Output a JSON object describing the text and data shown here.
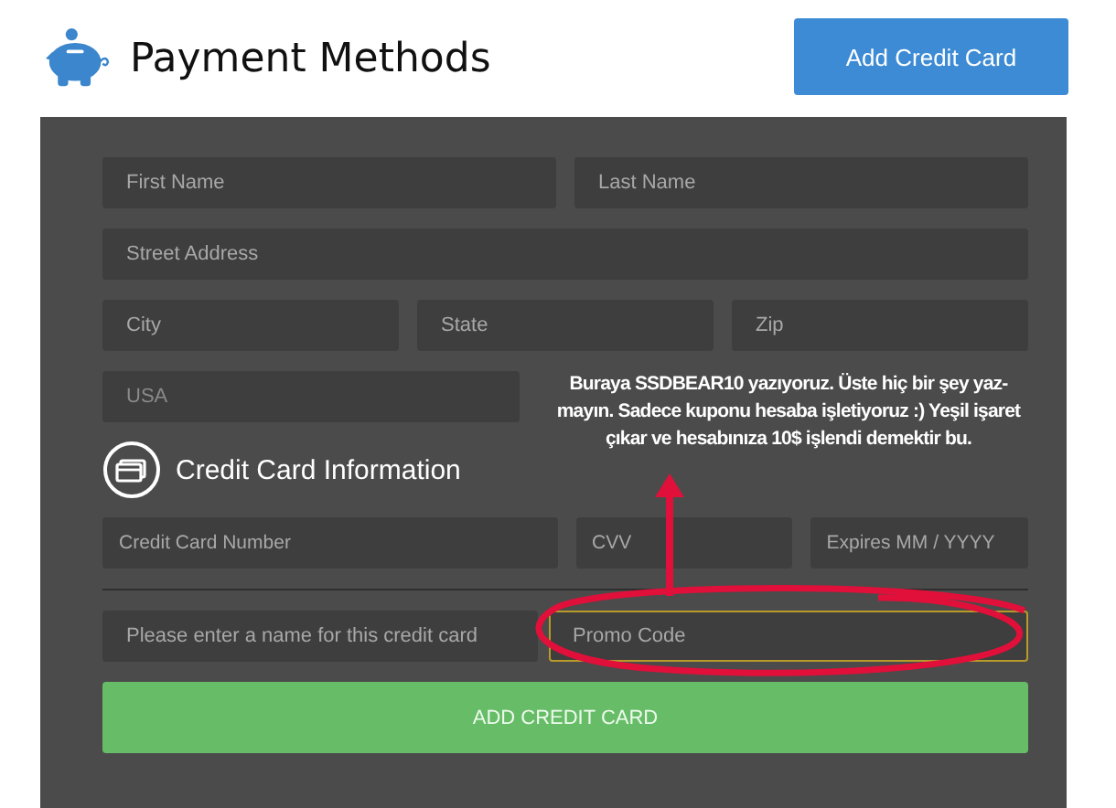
{
  "header": {
    "title": "Payment Methods",
    "button": "Add Credit Card"
  },
  "address_rows": [
    {
      "fields": [
        {
          "placeholder": "First Name"
        },
        {
          "placeholder": "Last Name"
        }
      ]
    },
    {
      "fields": [
        {
          "placeholder": "Street Address"
        }
      ]
    },
    {
      "fields": [
        {
          "placeholder": "City"
        },
        {
          "placeholder": "State"
        },
        {
          "placeholder": "Zip"
        }
      ]
    },
    {
      "fields": [
        {
          "value": "USA"
        }
      ]
    }
  ],
  "section_title": "Credit Card Information",
  "card_fields": [
    {
      "placeholder": "Credit Card Number"
    },
    {
      "placeholder": "CVV"
    },
    {
      "placeholder": "Expires MM / YYYY"
    }
  ],
  "name_field": {
    "placeholder": "Please enter a name for this credit card"
  },
  "promo_field": {
    "placeholder": "Promo Code",
    "highlighted": true
  },
  "submit_button": "ADD CREDIT CARD",
  "annotation": {
    "text": "Buraya SSDBEAR10 yazıyoruz. Üste hiç bir şey yaz-mayın. Sadece kuponu hesaba işletiyoruz :) Yeşil işaret çıkar ve hesabınıza 10$ işlendi demektir bu."
  }
}
